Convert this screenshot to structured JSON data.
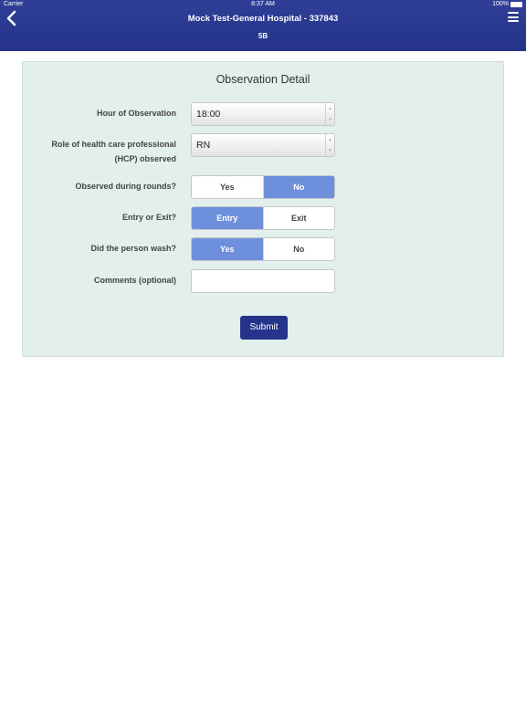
{
  "status_bar": {
    "carrier": "Carrier",
    "time": "8:37 AM",
    "battery": "100%"
  },
  "header": {
    "title": "Mock Test-General Hospital - 337843",
    "subtitle": "5B"
  },
  "panel": {
    "title": "Observation Detail",
    "hour_label": "Hour of Observation",
    "hour_value": "18:00",
    "role_label_line1": "Role of health care professional",
    "role_label_line2": "(HCP) observed",
    "role_value": "RN",
    "rounds_label": "Observed during rounds?",
    "rounds_yes": "Yes",
    "rounds_no": "No",
    "entry_label": "Entry or Exit?",
    "entry_option": "Entry",
    "exit_option": "Exit",
    "wash_label": "Did the person wash?",
    "wash_yes": "Yes",
    "wash_no": "No",
    "comments_label": "Comments (optional)",
    "submit_label": "Submit"
  },
  "selected": {
    "observed_during_rounds": "No",
    "entry_or_exit": "Entry",
    "did_wash": "Yes"
  },
  "colors": {
    "header": "#2a3990",
    "active_segment": "#6e8fdc",
    "panel_bg": "#e2efec",
    "submit": "#25338a"
  },
  "icons": {
    "back": "chevron-left-icon",
    "menu": "hamburger-menu-icon",
    "wifi": "wifi-icon",
    "battery": "battery-icon"
  }
}
